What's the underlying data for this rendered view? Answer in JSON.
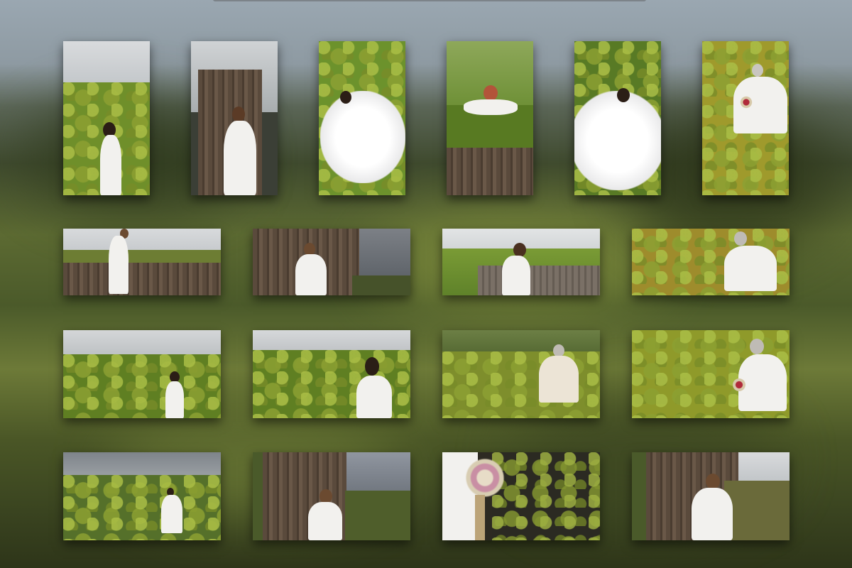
{
  "gallery": {
    "rows": [
      {
        "photos": [
          {
            "subject": "bride-in-moss-field-back-view",
            "orientation": "portrait"
          },
          {
            "subject": "bride-at-wooden-cabin-door",
            "orientation": "portrait"
          },
          {
            "subject": "bride-lying-on-moss",
            "orientation": "portrait"
          },
          {
            "subject": "bride-on-turf-roof-cabin",
            "orientation": "portrait"
          },
          {
            "subject": "bride-lying-on-moss-spread-dress",
            "orientation": "portrait"
          },
          {
            "subject": "older-bride-seated-on-moss-with-bouquet",
            "orientation": "portrait"
          }
        ]
      },
      {
        "photos": [
          {
            "subject": "bride-seated-on-cabin-roof",
            "orientation": "landscape"
          },
          {
            "subject": "bride-by-cabin-stormy-sky",
            "orientation": "landscape"
          },
          {
            "subject": "bride-resting-on-grass-roof",
            "orientation": "landscape"
          },
          {
            "subject": "older-bride-seated-in-moss",
            "orientation": "landscape"
          }
        ]
      },
      {
        "photos": [
          {
            "subject": "bride-standing-in-moss-field-fog",
            "orientation": "landscape"
          },
          {
            "subject": "bride-looking-over-moss-field",
            "orientation": "landscape"
          },
          {
            "subject": "older-bride-seated-in-forest-moss",
            "orientation": "landscape"
          },
          {
            "subject": "older-bride-with-bouquet-on-moss",
            "orientation": "landscape"
          }
        ]
      },
      {
        "photos": [
          {
            "subject": "bride-walking-lava-field",
            "orientation": "landscape"
          },
          {
            "subject": "bride-back-view-cabin-mountains",
            "orientation": "landscape"
          },
          {
            "subject": "dried-flower-bouquet-closeup",
            "orientation": "landscape"
          },
          {
            "subject": "bride-at-cabin-door-back-view",
            "orientation": "landscape"
          }
        ]
      }
    ]
  },
  "colors": {
    "moss_green": "#7a9a2e",
    "moss_yellow": "#b6a634",
    "sky_grey": "#c9ccd0",
    "dress_white": "#f3f2ef",
    "wood_brown": "#5a4a3c"
  }
}
